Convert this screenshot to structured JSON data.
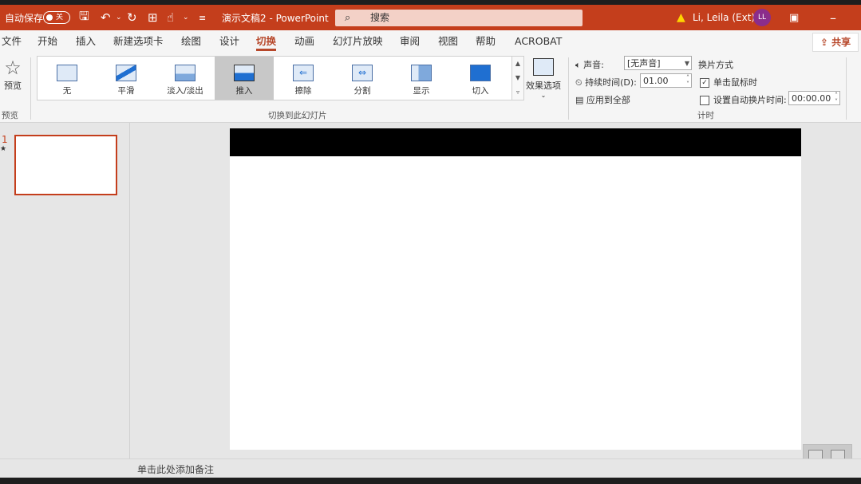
{
  "titlebar": {
    "autosave_label": "自动保存",
    "autosave_state": "关",
    "doc_title": "演示文稿2  -  PowerPoint",
    "search_placeholder": "搜索",
    "user_name": "Li, Leila (Ext)",
    "user_initials": "LL",
    "accent_color": "#c43e1c"
  },
  "tabs": [
    "文件",
    "开始",
    "插入",
    "新建选项卡",
    "绘图",
    "设计",
    "切换",
    "动画",
    "幻灯片放映",
    "审阅",
    "视图",
    "帮助",
    "ACROBAT"
  ],
  "active_tab": "切换",
  "share_label": "共享",
  "ribbon": {
    "preview_label": "预览",
    "preview_group_label": "预览",
    "gallery_group_label": "切换到此幻灯片",
    "transitions": [
      "无",
      "平滑",
      "淡入/淡出",
      "推入",
      "擦除",
      "分割",
      "显示",
      "切入"
    ],
    "selected_transition": "推入",
    "effect_options_label": "效果选项",
    "timing": {
      "sound_label": "声音:",
      "sound_value": "[无声音]",
      "duration_label": "持续时间(D):",
      "duration_value": "01.00",
      "apply_all_label": "应用到全部",
      "advance_label": "换片方式",
      "on_click_label": "单击鼠标时",
      "after_label": "设置自动换片时间:",
      "after_value": "00:00.00",
      "group_label": "计时"
    }
  },
  "slides": {
    "number": "1",
    "marker": "★"
  },
  "notes_placeholder": "单击此处添加备注"
}
